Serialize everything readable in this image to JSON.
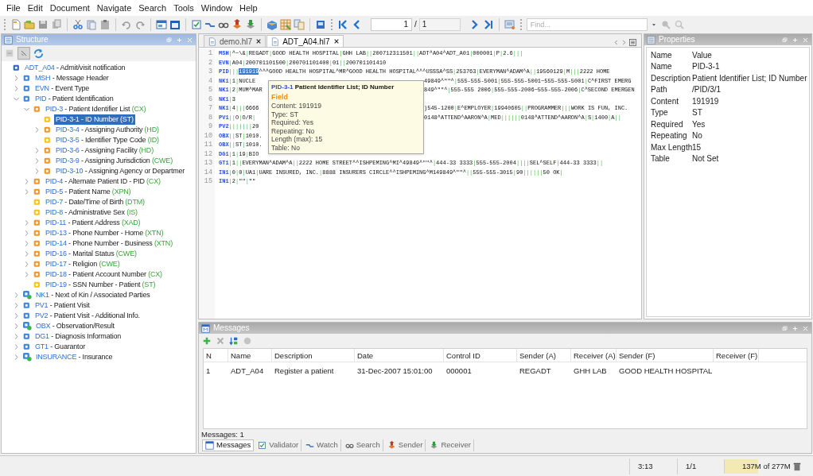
{
  "menu": [
    "File",
    "Edit",
    "Document",
    "Navigate",
    "Search",
    "Tools",
    "Window",
    "Help"
  ],
  "toolbar": {
    "page": "1",
    "page_separator": "/",
    "page_total": "1",
    "find_placeholder": "Find..."
  },
  "structure": {
    "title": "Structure",
    "tree": [
      {
        "id": "ADT_A04",
        "desc": "- Admit/visit notification",
        "kind": "message",
        "selected": false,
        "children": [
          {
            "id": "MSH",
            "desc": "- Message Header",
            "kind": "segment",
            "expanded": false,
            "selected": false
          },
          {
            "id": "EVN",
            "desc": "- Event Type",
            "kind": "segment",
            "expanded": false,
            "selected": false
          },
          {
            "id": "PID",
            "desc": "- Patient Identification",
            "kind": "segment",
            "expanded": true,
            "selected": false,
            "children": [
              {
                "id": "PID-3",
                "desc": "- Patient Identifier List",
                "type": "(CX)",
                "kind": "composite",
                "expanded": true,
                "selected": false,
                "children": [
                  {
                    "id": "PID-3-1",
                    "desc": "- ID Number",
                    "type": "(ST)",
                    "kind": "primitive",
                    "selected": true
                  },
                  {
                    "id": "PID-3-4",
                    "desc": "- Assigning Authority",
                    "type": "(HD)",
                    "kind": "composite",
                    "expanded": false,
                    "selected": false
                  },
                  {
                    "id": "PID-3-5",
                    "desc": "- Identifier Type Code",
                    "type": "(ID)",
                    "kind": "primitive",
                    "selected": false
                  },
                  {
                    "id": "PID-3-6",
                    "desc": "- Assigning Facility",
                    "type": "(HD)",
                    "kind": "composite",
                    "expanded": false,
                    "selected": false
                  },
                  {
                    "id": "PID-3-9",
                    "desc": "- Assigning Jurisdiction",
                    "type": "(CWE)",
                    "kind": "composite",
                    "expanded": false,
                    "selected": false
                  },
                  {
                    "id": "PID-3-10",
                    "desc": "- Assigning Agency or Departmer",
                    "kind": "composite",
                    "expanded": false,
                    "selected": false
                  }
                ]
              },
              {
                "id": "PID-4",
                "desc": "- Alternate Patient ID - PID",
                "type": "(CX)",
                "kind": "composite",
                "expanded": false,
                "selected": false
              },
              {
                "id": "PID-5",
                "desc": "- Patient Name",
                "type": "(XPN)",
                "kind": "composite",
                "expanded": false,
                "selected": false
              },
              {
                "id": "PID-7",
                "desc": "- Date/Time of Birth",
                "type": "(DTM)",
                "kind": "primitive",
                "selected": false
              },
              {
                "id": "PID-8",
                "desc": "- Administrative Sex",
                "type": "(IS)",
                "kind": "primitive",
                "selected": false
              },
              {
                "id": "PID-11",
                "desc": "- Patient Address",
                "type": "(XAD)",
                "kind": "composite",
                "expanded": false,
                "selected": false
              },
              {
                "id": "PID-13",
                "desc": "- Phone Number - Home",
                "type": "(XTN)",
                "kind": "composite",
                "expanded": false,
                "selected": false
              },
              {
                "id": "PID-14",
                "desc": "- Phone Number - Business",
                "type": "(XTN)",
                "kind": "composite",
                "expanded": false,
                "selected": false
              },
              {
                "id": "PID-16",
                "desc": "- Marital Status",
                "type": "(CWE)",
                "kind": "composite",
                "expanded": false,
                "selected": false
              },
              {
                "id": "PID-17",
                "desc": "- Religion",
                "type": "(CWE)",
                "kind": "composite",
                "expanded": false,
                "selected": false
              },
              {
                "id": "PID-18",
                "desc": "- Patient Account Number",
                "type": "(CX)",
                "kind": "composite",
                "expanded": false,
                "selected": false
              },
              {
                "id": "PID-19",
                "desc": "- SSN Number - Patient",
                "type": "(ST)",
                "kind": "primitive",
                "selected": false
              }
            ]
          },
          {
            "id": "NK1",
            "desc": "- Next of Kin / Associated Parties",
            "kind": "group",
            "expanded": false,
            "selected": false
          },
          {
            "id": "PV1",
            "desc": "- Patient Visit",
            "kind": "segment",
            "expanded": false,
            "selected": false
          },
          {
            "id": "PV2",
            "desc": "- Patient Visit - Additional Info.",
            "kind": "segment",
            "expanded": false,
            "selected": false
          },
          {
            "id": "OBX",
            "desc": "- Observation/Result",
            "kind": "group",
            "expanded": false,
            "selected": false
          },
          {
            "id": "DG1",
            "desc": "- Diagnosis Information",
            "kind": "segment",
            "expanded": false,
            "selected": false
          },
          {
            "id": "GT1",
            "desc": "- Guarantor",
            "kind": "segment",
            "expanded": false,
            "selected": false
          },
          {
            "id": "INSURANCE",
            "desc": "- Insurance",
            "kind": "group",
            "expanded": false,
            "selected": false
          }
        ]
      }
    ]
  },
  "editor": {
    "tabs": [
      {
        "label": "demo.hl7",
        "selected": false
      },
      {
        "label": "ADT_A04.hl7",
        "selected": true
      }
    ],
    "lines": [
      {
        "n": "1",
        "parts": [
          {
            "text": "MSH|^~\\&|REGADT|GOOD HEALTH HOSPITAL|GHH LAB||200712311501||ADT^A04^ADT_A01|000001|P|2.6|||",
            "selected": false
          }
        ]
      },
      {
        "n": "2",
        "parts": [
          {
            "text": "EVN|A04|200701101500|200701101400|01||200701101410",
            "selected": false
          }
        ]
      },
      {
        "n": "3",
        "parts": [
          {
            "text": "PID|||",
            "selected": false
          },
          {
            "text": "191919",
            "selected": true
          },
          {
            "text": "^^^GOOD HEALTH HOSPITAL^MR^GOOD HEALTH HOSPITAL^^^USSSA^SS|253763|EVERYMAN^ADAM^A||19560129|M|||2222 HOME",
            "selected": false
          }
        ]
      },
      {
        "n": "4",
        "parts": [
          {
            "text": "NK1|1|NUCLE",
            "selected": false
          }
        ],
        "after": "49849^\"\"^|555-555-5001|555-555-5001~555-555-5001|C^FIRST EMERG"
      },
      {
        "n": "5",
        "parts": [
          {
            "text": "NK1|2|MUM^MAR",
            "selected": false
          }
        ],
        "after": "849^\"\"^|555-555 2006|555-555-2006~555-555-2006|C^SECOND EMERGEN"
      },
      {
        "n": "6",
        "parts": [
          {
            "text": "NK1|3",
            "selected": false
          }
        ]
      },
      {
        "n": "7",
        "parts": [
          {
            "text": "NK1|4|||6666",
            "selected": false
          }
        ],
        "after": ")545-1200|E^EMPLOYER|19940605||PROGRAMMER|||WORK IS FUN, INC."
      },
      {
        "n": "8",
        "parts": [
          {
            "text": "PV1||O|O/R|",
            "selected": false
          }
        ],
        "after": "0148^ATTEND^AARON^A|MED||||||0148^ATTEND^AARON^A|S|1400|A||"
      },
      {
        "n": "9",
        "parts": [
          {
            "text": "PV2|||||||20",
            "selected": false
          }
        ]
      },
      {
        "n": "10",
        "parts": [
          {
            "text": "OBX||ST|1010.",
            "selected": false
          }
        ]
      },
      {
        "n": "11",
        "parts": [
          {
            "text": "OBX||ST|1010.",
            "selected": false
          }
        ]
      },
      {
        "n": "12",
        "parts": [
          {
            "text": "DG1|1|19|BIO",
            "selected": false
          }
        ]
      },
      {
        "n": "13",
        "parts": [
          {
            "text": "GT1|1||EVERYMAN^ADAM^A||2222 HOME STREET^^ISHPEMING^MI^49849^\"\"^|444-33 3333|555-555-2004||||SEL^SELF|444-33 3333||",
            "selected": false
          }
        ]
      },
      {
        "n": "14",
        "parts": [
          {
            "text": "IN1|0|0|UA1|UARE INSURED, INC.|8888 INSURERS CIRCLE^^ISHPEMING^M149849^\"\"^||555-555-3015|90||||||50 OK|",
            "selected": false
          }
        ]
      },
      {
        "n": "15",
        "parts": [
          {
            "text": "IN1|2|\"\"|\"\"",
            "selected": false
          }
        ]
      }
    ],
    "tooltip": {
      "id": "PID-3-1",
      "title": "Patient Identifier List; ID Number",
      "category": "Field",
      "details": [
        "Content: 191919",
        "Type: ST",
        "Required: Yes",
        "Repeating: No",
        "Length (max): 15",
        "Table: No"
      ]
    }
  },
  "properties": {
    "title": "Properties",
    "columns": [
      "Name",
      "Value"
    ],
    "rows": [
      [
        "Name",
        "PID-3-1"
      ],
      [
        "Description",
        "Patient Identifier List; ID Number"
      ],
      [
        "Path",
        "/PID/3/1"
      ],
      [
        "Content",
        "191919"
      ],
      [
        "Type",
        "ST"
      ],
      [
        "Required",
        "Yes"
      ],
      [
        "Repeating",
        "No"
      ],
      [
        "Max Length",
        "15"
      ],
      [
        "Table",
        "Not Set"
      ]
    ]
  },
  "messages": {
    "title": "Messages",
    "columns": [
      "N",
      "Name",
      "Description",
      "Date",
      "Control ID",
      "Sender (A)",
      "Receiver (A)",
      "Sender (F)",
      "Receiver (F)"
    ],
    "rows": [
      [
        "1",
        "ADT_A04",
        "Register a patient",
        "31-Dec-2007 15:01:00",
        "000001",
        "REGADT",
        "GHH LAB",
        "GOOD HEALTH HOSPITAL",
        ""
      ]
    ],
    "footer": "Messages: 1",
    "tabs": [
      {
        "label": "Messages",
        "selected": true
      },
      {
        "label": "Validator",
        "selected": false
      },
      {
        "label": "Watch",
        "selected": false
      },
      {
        "label": "Search",
        "selected": false
      },
      {
        "label": "Sender",
        "selected": false
      },
      {
        "label": "Receiver",
        "selected": false
      }
    ]
  },
  "status_bar": {
    "position": "3:13",
    "page": "1/1",
    "memory": "137M of 277M",
    "level": 0.49
  }
}
